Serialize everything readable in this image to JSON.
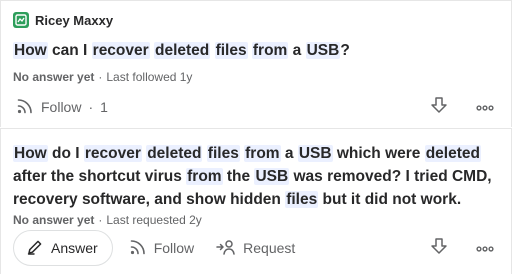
{
  "feed": [
    {
      "source": {
        "name": "Ricey Maxxy",
        "logo_color": "#2e9e5b",
        "icon": "space-logo-icon"
      },
      "question": {
        "segments": [
          {
            "text": "How",
            "hl": true
          },
          {
            "text": " can I ",
            "hl": false
          },
          {
            "text": "recover",
            "hl": true
          },
          {
            "text": " ",
            "hl": false
          },
          {
            "text": "deleted",
            "hl": true
          },
          {
            "text": " ",
            "hl": false
          },
          {
            "text": "files",
            "hl": true
          },
          {
            "text": " ",
            "hl": false
          },
          {
            "text": "from",
            "hl": true
          },
          {
            "text": " a ",
            "hl": false
          },
          {
            "text": "USB",
            "hl": true
          },
          {
            "text": "?",
            "hl": false
          }
        ]
      },
      "meta": {
        "status": "No answer yet",
        "separator": "·",
        "activity": "Last followed 1y"
      },
      "actions": {
        "follow_label": "Follow",
        "follow_separator": "·",
        "follow_count": "1"
      }
    },
    {
      "question": {
        "segments": [
          {
            "text": "How",
            "hl": true
          },
          {
            "text": " do I ",
            "hl": false
          },
          {
            "text": "recover",
            "hl": true
          },
          {
            "text": " ",
            "hl": false
          },
          {
            "text": "deleted",
            "hl": true
          },
          {
            "text": " ",
            "hl": false
          },
          {
            "text": "files",
            "hl": true
          },
          {
            "text": " ",
            "hl": false
          },
          {
            "text": "from",
            "hl": true
          },
          {
            "text": " a ",
            "hl": false
          },
          {
            "text": "USB",
            "hl": true
          },
          {
            "text": " which were ",
            "hl": false
          },
          {
            "text": "deleted",
            "hl": true
          },
          {
            "text": " after the shortcut virus ",
            "hl": false
          },
          {
            "text": "from",
            "hl": true
          },
          {
            "text": " the ",
            "hl": false
          },
          {
            "text": "USB",
            "hl": true
          },
          {
            "text": " was removed? I tried CMD, recovery software, and show hidden ",
            "hl": false
          },
          {
            "text": "files",
            "hl": true
          },
          {
            "text": " but it did not work.",
            "hl": false
          }
        ]
      },
      "meta": {
        "status": "No answer yet",
        "separator": "·",
        "activity": "Last requested 2y"
      },
      "actions": {
        "answer_label": "Answer",
        "follow_label": "Follow",
        "request_label": "Request"
      }
    }
  ],
  "colors": {
    "highlight": "#ebf0ff",
    "text": "#282829",
    "muted": "#636466",
    "border": "#e6e6e6"
  }
}
